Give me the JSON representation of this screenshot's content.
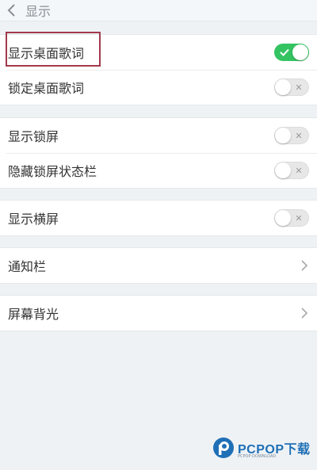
{
  "header": {
    "title": "显示"
  },
  "groups": [
    {
      "rows": [
        {
          "label": "显示桌面歌词",
          "type": "switch",
          "on": true
        },
        {
          "label": "锁定桌面歌词",
          "type": "switch",
          "on": false
        }
      ]
    },
    {
      "rows": [
        {
          "label": "显示锁屏",
          "type": "switch",
          "on": false
        },
        {
          "label": "隐藏锁屏状态栏",
          "type": "switch",
          "on": false
        }
      ]
    },
    {
      "rows": [
        {
          "label": "显示横屏",
          "type": "switch",
          "on": false
        }
      ]
    },
    {
      "rows": [
        {
          "label": "通知栏",
          "type": "link"
        }
      ]
    },
    {
      "rows": [
        {
          "label": "屏幕背光",
          "type": "link"
        }
      ]
    }
  ],
  "watermark": {
    "brand": "PCPOP下载",
    "sub": "PCPOP DOWNLOAD"
  },
  "colors": {
    "switch_on": "#34c361",
    "switch_off": "#e7e7e7",
    "highlight": "#a23a4a",
    "brand": "#1f6fb6"
  },
  "icons": {
    "back": "chevron-left-icon",
    "link": "chevron-right-icon",
    "check": "check-icon",
    "x": "x-mark-icon"
  }
}
